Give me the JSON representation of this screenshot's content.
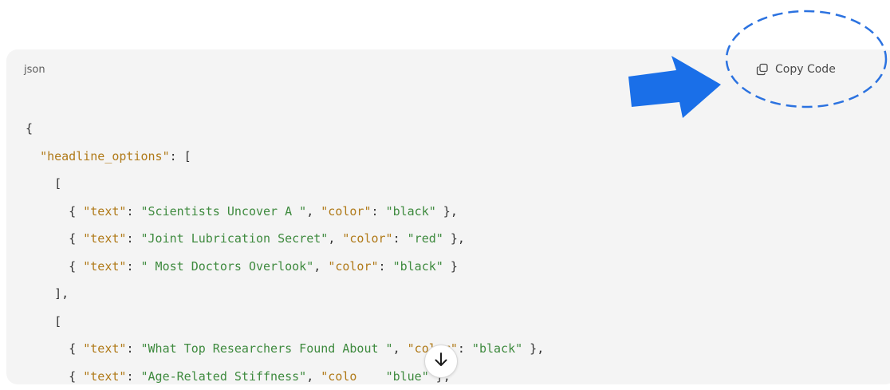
{
  "code_block": {
    "language": "json",
    "copy_label": "Copy Code",
    "lines": [
      [
        {
          "t": "p",
          "v": "{"
        }
      ],
      [
        {
          "t": "p",
          "v": "  "
        },
        {
          "t": "k",
          "v": "\"headline_options\""
        },
        {
          "t": "p",
          "v": ": ["
        }
      ],
      [
        {
          "t": "p",
          "v": "    ["
        }
      ],
      [
        {
          "t": "p",
          "v": "      { "
        },
        {
          "t": "k",
          "v": "\"text\""
        },
        {
          "t": "p",
          "v": ": "
        },
        {
          "t": "s",
          "v": "\"Scientists Uncover A \""
        },
        {
          "t": "p",
          "v": ", "
        },
        {
          "t": "k",
          "v": "\"color\""
        },
        {
          "t": "p",
          "v": ": "
        },
        {
          "t": "s",
          "v": "\"black\""
        },
        {
          "t": "p",
          "v": " },"
        }
      ],
      [
        {
          "t": "p",
          "v": "      { "
        },
        {
          "t": "k",
          "v": "\"text\""
        },
        {
          "t": "p",
          "v": ": "
        },
        {
          "t": "s",
          "v": "\"Joint Lubrication Secret\""
        },
        {
          "t": "p",
          "v": ", "
        },
        {
          "t": "k",
          "v": "\"color\""
        },
        {
          "t": "p",
          "v": ": "
        },
        {
          "t": "s",
          "v": "\"red\""
        },
        {
          "t": "p",
          "v": " },"
        }
      ],
      [
        {
          "t": "p",
          "v": "      { "
        },
        {
          "t": "k",
          "v": "\"text\""
        },
        {
          "t": "p",
          "v": ": "
        },
        {
          "t": "s",
          "v": "\" Most Doctors Overlook\""
        },
        {
          "t": "p",
          "v": ", "
        },
        {
          "t": "k",
          "v": "\"color\""
        },
        {
          "t": "p",
          "v": ": "
        },
        {
          "t": "s",
          "v": "\"black\""
        },
        {
          "t": "p",
          "v": " }"
        }
      ],
      [
        {
          "t": "p",
          "v": "    ],"
        }
      ],
      [
        {
          "t": "p",
          "v": "    ["
        }
      ],
      [
        {
          "t": "p",
          "v": "      { "
        },
        {
          "t": "k",
          "v": "\"text\""
        },
        {
          "t": "p",
          "v": ": "
        },
        {
          "t": "s",
          "v": "\"What Top Researchers Found About \""
        },
        {
          "t": "p",
          "v": ", "
        },
        {
          "t": "k",
          "v": "\"color\""
        },
        {
          "t": "p",
          "v": ": "
        },
        {
          "t": "s",
          "v": "\"black\""
        },
        {
          "t": "p",
          "v": " },"
        }
      ],
      [
        {
          "t": "p",
          "v": "      { "
        },
        {
          "t": "k",
          "v": "\"text\""
        },
        {
          "t": "p",
          "v": ": "
        },
        {
          "t": "s",
          "v": "\"Age-Related Stiffness\""
        },
        {
          "t": "p",
          "v": ", "
        },
        {
          "t": "k",
          "v": "\"colo"
        },
        {
          "t": "p",
          "v": "    "
        },
        {
          "t": "s",
          "v": "\"blue\""
        },
        {
          "t": "p",
          "v": " },"
        }
      ]
    ]
  },
  "annotations": {
    "arrow_color": "#1a6fe8",
    "ellipse_color": "#2b72e0"
  },
  "icons": {
    "copy": "copy-icon",
    "scroll": "arrow-down-icon"
  },
  "colors": {
    "panel_bg": "#f4f4f4",
    "key": "#b07a19",
    "string": "#3e8a3e",
    "punctuation": "#333333"
  }
}
